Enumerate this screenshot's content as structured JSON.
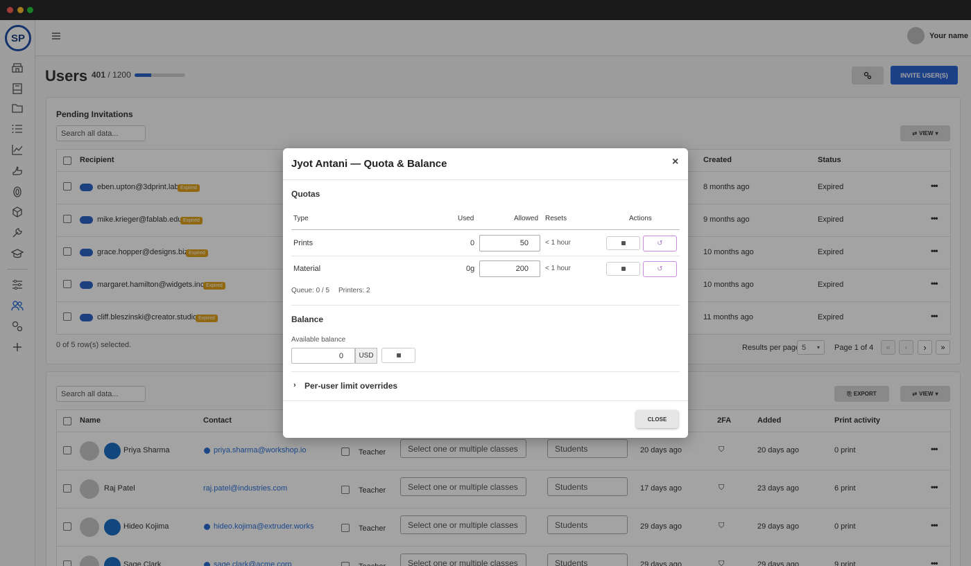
{
  "topbar": {
    "user_name": "Your name"
  },
  "header": {
    "title": "Users",
    "count": "401",
    "separator": "/",
    "limit": "1200",
    "progress": 0.334,
    "invite_label": "INVITE USER(S)"
  },
  "pending": {
    "title": "Pending Invitations",
    "search_placeholder": "Search all data...",
    "view_label": "VIEW",
    "columns": {
      "recipient": "Recipient",
      "created": "Created",
      "status": "Status"
    },
    "rows": [
      {
        "email": "eben.upton@3dprint.lab",
        "badge": "Expired",
        "created": "8 months ago",
        "status": "Expired"
      },
      {
        "email": "mike.krieger@fablab.edu",
        "badge": "Expired",
        "created": "9 months ago",
        "status": "Expired"
      },
      {
        "email": "grace.hopper@designs.biz",
        "badge": "Expired",
        "created": "10 months ago",
        "status": "Expired"
      },
      {
        "email": "margaret.hamilton@widgets.inc",
        "badge": "Expired",
        "created": "10 months ago",
        "status": "Expired"
      },
      {
        "email": "cliff.bleszinski@creator.studio",
        "badge": "Expired",
        "created": "11 months ago",
        "status": "Expired"
      }
    ],
    "selected_text": "0 of 5 row(s) selected.",
    "results_label": "Results per page",
    "per_page": "5",
    "page_text": "Page 1 of 4"
  },
  "users": {
    "search_placeholder": "Search all data...",
    "export_label": "EXPORT",
    "view_label": "VIEW",
    "columns": {
      "name": "Name",
      "contact": "Contact",
      "twofa": "2FA",
      "added": "Added",
      "activity": "Print activity"
    },
    "class_placeholder": "Select one or multiple classes",
    "rows": [
      {
        "name": "Priya Sharma",
        "email": "priya.sharma@workshop.io",
        "role": "Teacher",
        "group": "Students",
        "last": "20 days ago",
        "added": "20 days ago",
        "activity": "0 print"
      },
      {
        "name": "Raj Patel",
        "email": "raj.patel@industries.com",
        "role": "Teacher",
        "group": "Students",
        "last": "17 days ago",
        "added": "23 days ago",
        "activity": "6 print"
      },
      {
        "name": "Hideo Kojima",
        "email": "hideo.kojima@extruder.works",
        "role": "Teacher",
        "group": "Students",
        "last": "29 days ago",
        "added": "29 days ago",
        "activity": "0 print"
      },
      {
        "name": "Sage Clark",
        "email": "sage.clark@acme.corp",
        "role": "Teacher",
        "group": "Students",
        "last": "29 days ago",
        "added": "29 days ago",
        "activity": "9 print"
      }
    ]
  },
  "modal": {
    "title": "Jyot Antani — Quota & Balance",
    "close_x": "×",
    "quotas_title": "Quotas",
    "cols": {
      "type": "Type",
      "used": "Used",
      "allowed": "Allowed",
      "resets": "Resets",
      "actions": "Actions"
    },
    "rows": [
      {
        "type": "Prints",
        "used": "0",
        "allowed": "50",
        "resets": "< 1 hour"
      },
      {
        "type": "Material",
        "used": "0g",
        "allowed": "200",
        "resets": "< 1 hour"
      }
    ],
    "queue": "Queue: 0 / 5",
    "printers": "Printers: 2",
    "balance_title": "Balance",
    "available_label": "Available balance",
    "balance_value": "0",
    "currency": "USD",
    "overrides_label": "Per-user limit overrides",
    "close_label": "CLOSE"
  }
}
